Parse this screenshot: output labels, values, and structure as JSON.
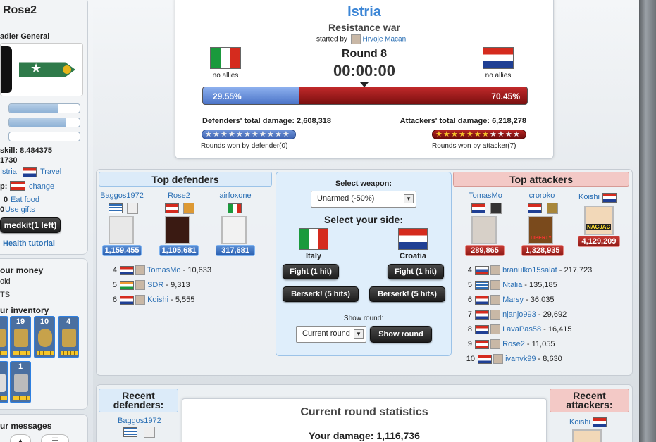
{
  "sidebar": {
    "username": "Rose2",
    "rank": "adier General",
    "skill": "skill: 8.484375",
    "val2": "1730",
    "location_name": "Istria",
    "travel": "Travel",
    "cit_label": "p:",
    "change": "change",
    "eat_food_count": "0",
    "eat_food": "Eat food",
    "use_gifts_count": "0",
    "use_gifts": "Use gifts",
    "medkit": "medkit(1 left)",
    "health_tutorial": "Health tutorial",
    "money_title": "our money",
    "money_line1": "old",
    "money_line2": "TS",
    "inventory_title": "ur inventory",
    "inventory_counts": [
      "19",
      "10",
      "4",
      "1"
    ],
    "messages_title": "ur messages"
  },
  "battle": {
    "region": "Istria",
    "type": "Resistance war",
    "started_by_label": "started by",
    "started_by": "Hrvoje Macan",
    "round": "Round 8",
    "timer": "00:00:00",
    "left_allies": "no allies",
    "right_allies": "no allies",
    "defender_pct": "29.55%",
    "attacker_pct": "70.45%",
    "defender_share": 0.2955,
    "defenders_damage_label": "Defenders' total damage:",
    "defenders_damage": "2,608,318",
    "attackers_damage_label": "Attackers' total damage:",
    "attackers_damage": "6,218,278",
    "rounds_def": "Rounds won by defender(0)",
    "rounds_att": "Rounds won by attacker(7)",
    "rounds_won_defender": 0,
    "rounds_won_attacker": 7
  },
  "top_defenders": {
    "title": "Top defenders",
    "top3": [
      {
        "name": "Baggos1972",
        "damage": "1,159,455"
      },
      {
        "name": "Rose2",
        "damage": "1,105,681"
      },
      {
        "name": "airfoxone",
        "damage": "317,681"
      }
    ],
    "rows": [
      {
        "rank": "4",
        "name": "TomasMo",
        "damage": "- 10,633"
      },
      {
        "rank": "5",
        "name": "SDR",
        "damage": "- 9,313"
      },
      {
        "rank": "6",
        "name": "Koishi",
        "damage": "- 5,555"
      }
    ]
  },
  "controls": {
    "select_weapon": "Select weapon:",
    "weapon_value": "Unarmed (-50%)",
    "select_side": "Select your side:",
    "side_left": "Italy",
    "side_right": "Croatia",
    "fight": "Fight (1 hit)",
    "berserk": "Berserk! (5 hits)",
    "show_round_label": "Show round:",
    "round_value": "Current round",
    "show_round_btn": "Show round"
  },
  "top_attackers": {
    "title": "Top attackers",
    "top3": [
      {
        "name": "TomasMo",
        "damage": "289,865"
      },
      {
        "name": "croroko",
        "damage": "1,328,935"
      },
      {
        "name": "Koishi",
        "damage": "4,129,209"
      }
    ],
    "rows": [
      {
        "rank": "4",
        "name": "branulko15salat",
        "damage": "- 217,723"
      },
      {
        "rank": "5",
        "name": "Ntalia",
        "damage": "- 135,185"
      },
      {
        "rank": "6",
        "name": "Marsy",
        "damage": "- 36,035"
      },
      {
        "rank": "7",
        "name": "njanjo993",
        "damage": "- 29,692"
      },
      {
        "rank": "8",
        "name": "LavaPas58",
        "damage": "- 16,415"
      },
      {
        "rank": "9",
        "name": "Rose2",
        "damage": "- 11,055"
      },
      {
        "rank": "10",
        "name": "ivanvk99",
        "damage": "- 8,630"
      }
    ]
  },
  "bottom": {
    "recent_defenders": "Recent defenders:",
    "recent_def_name": "Baggos1972",
    "stats_title": "Current round statistics",
    "your_damage_label": "Your damage:",
    "your_damage": "1,116,736",
    "recent_attackers": "Recent attackers:",
    "recent_att_name": "Koishi"
  },
  "avatar_tags": {
    "croroko": "LIBERTY",
    "koishi": "NACJAC"
  },
  "colors": {
    "defender_blue": "#5a86d6",
    "attacker_red": "#a01c1a",
    "link": "#2a6fb4"
  }
}
